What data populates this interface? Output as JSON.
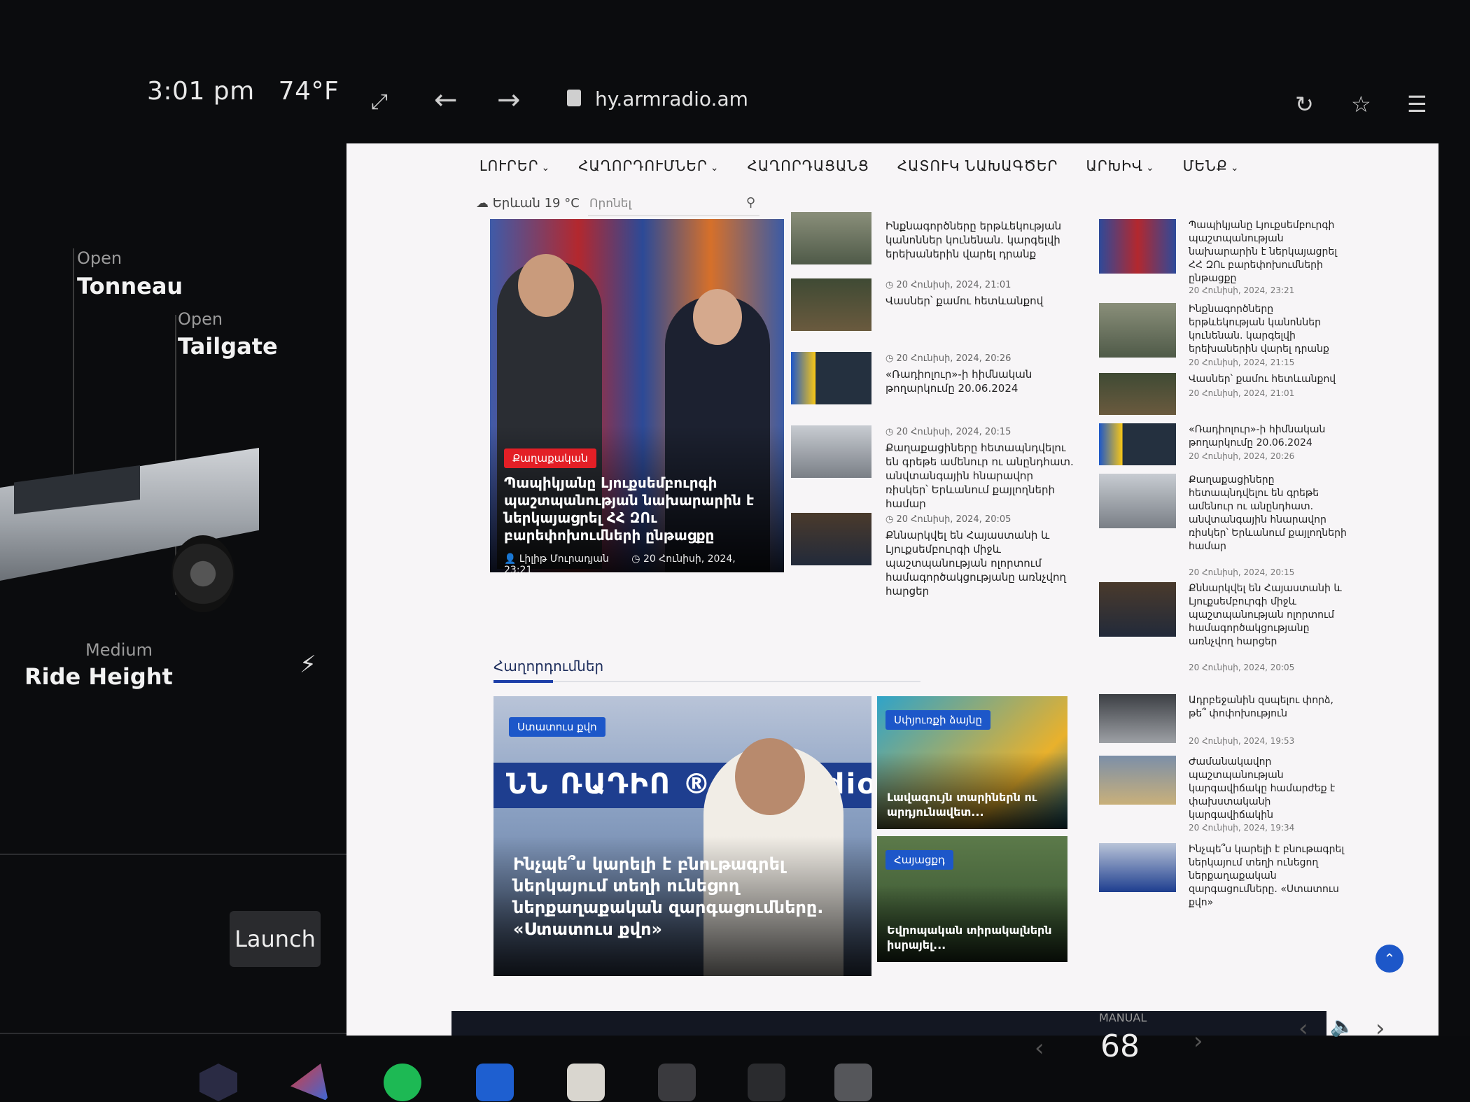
{
  "status": {
    "time": "3:01 pm",
    "temperature": "74°F"
  },
  "car": {
    "tonneau_action": "Open",
    "tonneau_label": "Tonneau",
    "tailgate_action": "Open",
    "tailgate_label": "Tailgate",
    "ride_height_value": "Medium",
    "ride_height_label": "Ride Height",
    "launch_label": "Launch"
  },
  "browser": {
    "url": "hy.armradio.am"
  },
  "site": {
    "nav": [
      "ԼՈՒՐԵՐ",
      "ՀԱՂՈՐԴՈՒՄՆԵՐ",
      "ՀԱՂՈՐԴԱՑԱՆՑ",
      "ՀԱՏՈՒԿ ՆԱԽԱԳԾԵՐ",
      "ԱՐԽԻՎ",
      "ՄԵՆՔ"
    ],
    "weather": "Երևան 19 °C",
    "search_placeholder": "Որոնել",
    "hero": {
      "category": "Քաղաքական",
      "title": "Պապիկյանը Լյուքսեմբուրգի պաշտպանության նախարարին է ներկայացրել ՀՀ ԶՈւ բարեփոխումների ընթացքը",
      "author": "Լիլիթ Մուրադյան",
      "date": "20 Հունիսի, 2024, 23:21"
    },
    "mid_news": [
      {
        "date": "",
        "title": "Ինքնագործները երթևեկության կանոններ կունենան. կարգելվի երեխաներին վարել դրանք"
      },
      {
        "date": "20 Հունիսի, 2024, 21:01",
        "title": "Վասներ՝ քամու հետևանքով"
      },
      {
        "date": "20 Հունիսի, 2024, 20:26",
        "title": "«Ռադիոլուր»-ի հիմնական թողարկումը 20.06.2024"
      },
      {
        "date": "20 Հունիսի, 2024, 20:15",
        "title": "Քաղաքացիները հետապնդվելու են գրեթե ամենուր ու անընդհատ. անվտանգային հնարավոր ռիսկեր՝ Երևանում քայլողների համար"
      },
      {
        "date": "20 Հունիսի, 2024, 20:05",
        "title": "Քննարկվել են Հայաստանի և Լյուքսեմբուրգի միջև պաշտպանության ոլորտում համագործակցությանը առնչվող հարցեր"
      }
    ],
    "side_news": [
      {
        "title": "Պապիկյանը Լյուքսեմբուրգի պաշտպանության նախարարին է ներկայացրել ՀՀ ԶՈւ բարեփոխումների ընթացքը",
        "date": "20 Հունիսի, 2024, 23:21"
      },
      {
        "title": "Ինքնագործները երթևեկության կանոններ կունենան. կարգելվի երեխաներին վարել դրանք",
        "date": "20 Հունիսի, 2024, 21:15"
      },
      {
        "title": "Վասներ՝ քամու հետևանքով",
        "date": "20 Հունիսի, 2024, 21:01"
      },
      {
        "title": "«Ռադիոլուր»-ի հիմնական թողարկումը 20.06.2024",
        "date": "20 Հունիսի, 2024, 20:26"
      },
      {
        "title": "Քաղաքացիները հետապնդվելու են գրեթե ամենուր ու անընդհատ. անվտանգային հնարավոր ռիսկեր՝ Երևանում քայլողների համար",
        "date": "20 Հունիսի, 2024, 20:15"
      },
      {
        "title": "Քննարկվել են Հայաստանի և Լյուքսեմբուրգի միջև պաշտպանության ոլորտում համագործակցությանը առնչվող հարցեր",
        "date": "20 Հունիսի, 2024, 20:05"
      },
      {
        "title": "Ադրբեջանին զսպելու փորձ, թե՞ փոփոխություն",
        "date": "20 Հունիսի, 2024, 19:53"
      },
      {
        "title": "Ժամանակավոր պաշտպանության կարգավիճակը համարժեք է փախստականի կարգավիճակին",
        "date": "20 Հունիսի, 2024, 19:34"
      },
      {
        "title": "Ինչպե՞ս կարելի է բնութագրել ներկայում տեղի ունեցող ներքաղաքական զարգացումները. «Ստատուս քվո»",
        "date": ""
      }
    ],
    "section_title": "Հաղորդումներ",
    "big_card": {
      "category": "Ստատուս քվո",
      "banner": "ՆՆ ՌԱԴԻՈ ® armradio.am",
      "title": "Ինչպե՞ս կարելի է բնութագրել ներկայում տեղի ունեցող ներքաղաքական զարգացումները. «Ստատուս քվո»"
    },
    "small_cards": [
      {
        "category": "Սփյուռքի ձայնը",
        "title": "Լավագույն տարիներն ու արդյունավետ..."
      },
      {
        "category": "Հայացքդ",
        "title": "Եվրոպական տիրակալներն իսրայել..."
      }
    ]
  },
  "dock": {
    "temp_mode": "MANUAL",
    "cabin_temp": "68"
  },
  "colors": {
    "accent_blue": "#1d57c9",
    "accent_red": "#e31f26",
    "page_bg": "#f7f5f7",
    "screen_bg": "#0b0c0e"
  }
}
